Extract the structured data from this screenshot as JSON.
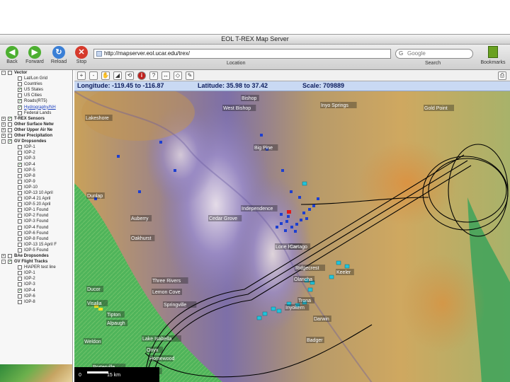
{
  "window": {
    "title": "EOL T-REX Map Server"
  },
  "toolbar": {
    "back": "Back",
    "forward": "Forward",
    "reload": "Reload",
    "stop": "Stop",
    "url": "http://mapserver.eol.ucar.edu/trex/",
    "location_label": "Location",
    "search_placeholder": "Google",
    "search_label": "Search",
    "bookmarks": "Bookmarks"
  },
  "layers": [
    {
      "label": "Vector",
      "type": "group",
      "indent": 0,
      "expander": "-",
      "checked": false
    },
    {
      "label": "Lat/Lon Grid",
      "type": "item",
      "indent": 1,
      "checked": false
    },
    {
      "label": "Countries",
      "type": "item",
      "indent": 1,
      "checked": false
    },
    {
      "label": "US States",
      "type": "item",
      "indent": 1,
      "checked": true
    },
    {
      "label": "US Cities",
      "type": "item",
      "indent": 1,
      "checked": false
    },
    {
      "label": "Roads(RT5)",
      "type": "item",
      "indent": 1,
      "checked": true
    },
    {
      "label": "Hydrography/NH",
      "type": "link",
      "indent": 1,
      "checked": true
    },
    {
      "label": "Federal Lands",
      "type": "item",
      "indent": 1,
      "checked": false
    },
    {
      "label": "T-REX Sensors",
      "type": "group",
      "indent": 0,
      "expander": "+",
      "checked": true
    },
    {
      "label": "Other Surface Netw",
      "type": "group",
      "indent": 0,
      "expander": "+",
      "checked": false
    },
    {
      "label": "Other Upper Air Ne",
      "type": "group",
      "indent": 0,
      "expander": "+",
      "checked": false
    },
    {
      "label": "Other Precipitation",
      "type": "group",
      "indent": 0,
      "expander": "+",
      "checked": false
    },
    {
      "label": "GV Dropsondes",
      "type": "group",
      "indent": 0,
      "expander": "-",
      "checked": true
    },
    {
      "label": "IOP-1",
      "type": "item",
      "indent": 1,
      "checked": false
    },
    {
      "label": "IOP-2",
      "type": "item",
      "indent": 1,
      "checked": false
    },
    {
      "label": "IOP-3",
      "type": "item",
      "indent": 1,
      "checked": false
    },
    {
      "label": "IOP-4",
      "type": "item",
      "indent": 1,
      "checked": true
    },
    {
      "label": "IOP-5",
      "type": "item",
      "indent": 1,
      "checked": false
    },
    {
      "label": "IOP-8",
      "type": "item",
      "indent": 1,
      "checked": false
    },
    {
      "label": "IOP-9",
      "type": "item",
      "indent": 1,
      "checked": false
    },
    {
      "label": "IOP-10",
      "type": "item",
      "indent": 1,
      "checked": false
    },
    {
      "label": "IOP-13 10 April",
      "type": "item",
      "indent": 1,
      "checked": false
    },
    {
      "label": "IOP-4 21 April",
      "type": "item",
      "indent": 1,
      "checked": false
    },
    {
      "label": "IOP-5 20 April",
      "type": "item",
      "indent": 1,
      "checked": false
    },
    {
      "label": "IOP-1 Found",
      "type": "item",
      "indent": 1,
      "checked": false
    },
    {
      "label": "IOP-2 Found",
      "type": "item",
      "indent": 1,
      "checked": false
    },
    {
      "label": "IOP-3 Found",
      "type": "item",
      "indent": 1,
      "checked": false
    },
    {
      "label": "IOP-4 Found",
      "type": "item",
      "indent": 1,
      "checked": false
    },
    {
      "label": "IOP-6 Found",
      "type": "item",
      "indent": 1,
      "checked": false
    },
    {
      "label": "IOP-8 Found",
      "type": "item",
      "indent": 1,
      "checked": false
    },
    {
      "label": "IOP-13 15 April F",
      "type": "item",
      "indent": 1,
      "checked": false
    },
    {
      "label": "IOP-5 Found",
      "type": "item",
      "indent": 1,
      "checked": false
    },
    {
      "label": "BAe Dropsondes",
      "type": "group",
      "indent": 0,
      "expander": "+",
      "checked": false
    },
    {
      "label": "GV Flight Tracks",
      "type": "group",
      "indent": 0,
      "expander": "-",
      "checked": true
    },
    {
      "label": "HIAPER test line",
      "type": "item",
      "indent": 1,
      "checked": false
    },
    {
      "label": "IOP-1",
      "type": "item",
      "indent": 1,
      "checked": false
    },
    {
      "label": "IOP-2",
      "type": "item",
      "indent": 1,
      "checked": false
    },
    {
      "label": "IOP-3",
      "type": "item",
      "indent": 1,
      "checked": false
    },
    {
      "label": "IOP-4",
      "type": "item",
      "indent": 1,
      "checked": true
    },
    {
      "label": "IOP-6",
      "type": "item",
      "indent": 1,
      "checked": false
    },
    {
      "label": "IOP-8",
      "type": "item",
      "indent": 1,
      "checked": false
    }
  ],
  "map_tools": [
    {
      "name": "zoom-in-tool",
      "glyph": "+"
    },
    {
      "name": "zoom-out-tool",
      "glyph": "-"
    },
    {
      "name": "pan-tool",
      "glyph": "✋"
    },
    {
      "name": "zoom-extent-tool",
      "glyph": "◢"
    },
    {
      "name": "refresh-tool",
      "glyph": "⟲"
    },
    {
      "name": "info-tool",
      "glyph": "i"
    },
    {
      "name": "query-tool",
      "glyph": "?"
    },
    {
      "name": "measure-tool",
      "glyph": "↔"
    },
    {
      "name": "select-tool",
      "glyph": "◇"
    },
    {
      "name": "draw-tool",
      "glyph": "✎"
    }
  ],
  "coords": {
    "longitude": "Longitude: -119.45 to -116.87",
    "latitude": "Latitude: 35.98 to 37.42",
    "scale": "Scale: 709889"
  },
  "map": {
    "place_labels": [
      "Bishop",
      "West Bishop",
      "Inyo Springs",
      "Gold Point",
      "Big Pine",
      "Lakeshore",
      "Independence",
      "Dunlap",
      "Auberry",
      "Oakhurst",
      "Cedar Grove",
      "Lone Pine",
      "Keeler",
      "Darwin",
      "Badger",
      "Three Rivers",
      "Lemon Cove",
      "Springville",
      "Ducor",
      "Porterville",
      "Alpaugh",
      "Visalia",
      "Tipton",
      "Weldon",
      "Lake Isabella",
      "Onyx",
      "Homewood",
      "Kernville",
      "Olancha",
      "Cartago",
      "Trona",
      "Ridgecrest",
      "Inyokern"
    ],
    "scale_labels": [
      "0",
      "15 km"
    ],
    "colors": {
      "coord_bar": "#c9d9f3",
      "coord_text": "#102060",
      "flight_track": "#000000",
      "dropsonde": "#1d3fd1",
      "station": "#21c4dc"
    }
  }
}
